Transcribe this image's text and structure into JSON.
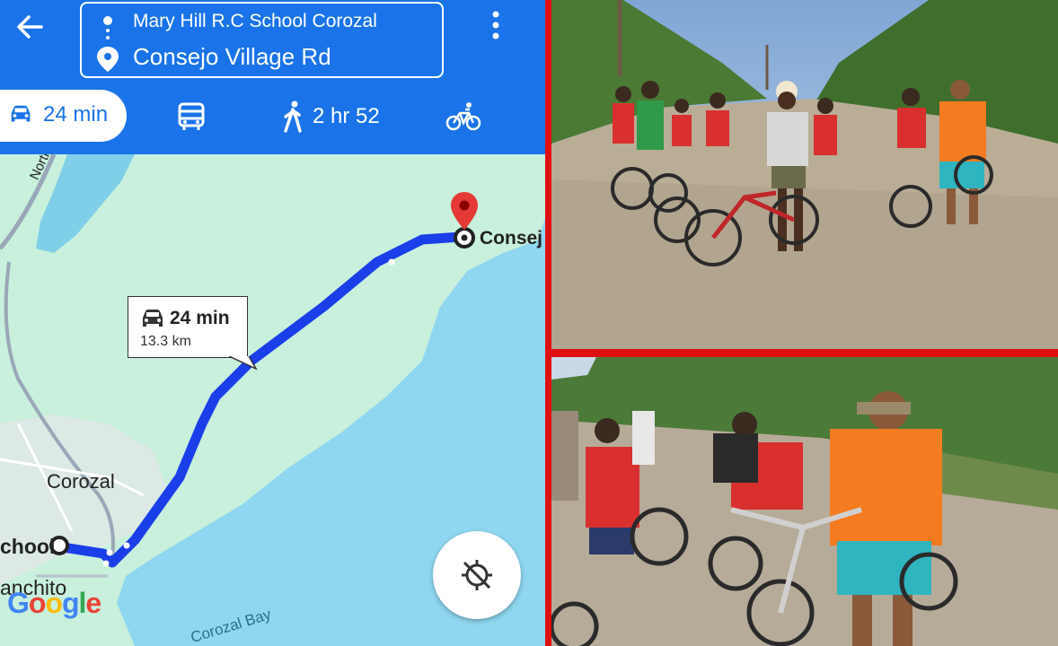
{
  "directions": {
    "origin": "Mary Hill R.C School Corozal",
    "destination": "Consejo Village Rd"
  },
  "modes": {
    "drive": {
      "label": "24 min",
      "icon": "car-icon"
    },
    "transit": {
      "icon": "bus-icon"
    },
    "walk": {
      "label": "2 hr 52",
      "icon": "walk-icon"
    },
    "bike": {
      "icon": "bike-icon"
    }
  },
  "map": {
    "route_callout": {
      "time": "24 min",
      "distance": "13.3 km"
    },
    "labels": {
      "road": "Northern",
      "town": "Corozal",
      "origin_partial": "chool",
      "dest_partial": "Consej",
      "bay": "Corozal Bay",
      "ranchito_partial": "anchito"
    },
    "logo": "Google"
  },
  "colors": {
    "header": "#1a73e8",
    "route": "#1a3ee8",
    "water": "#8fd7f0",
    "land": "#c8f0dc",
    "pin": "#e53935",
    "border": "#e01010"
  },
  "photos": [
    {
      "icon": "group-cyclists-photo"
    },
    {
      "icon": "adults-helping-children-bikes-photo"
    }
  ]
}
